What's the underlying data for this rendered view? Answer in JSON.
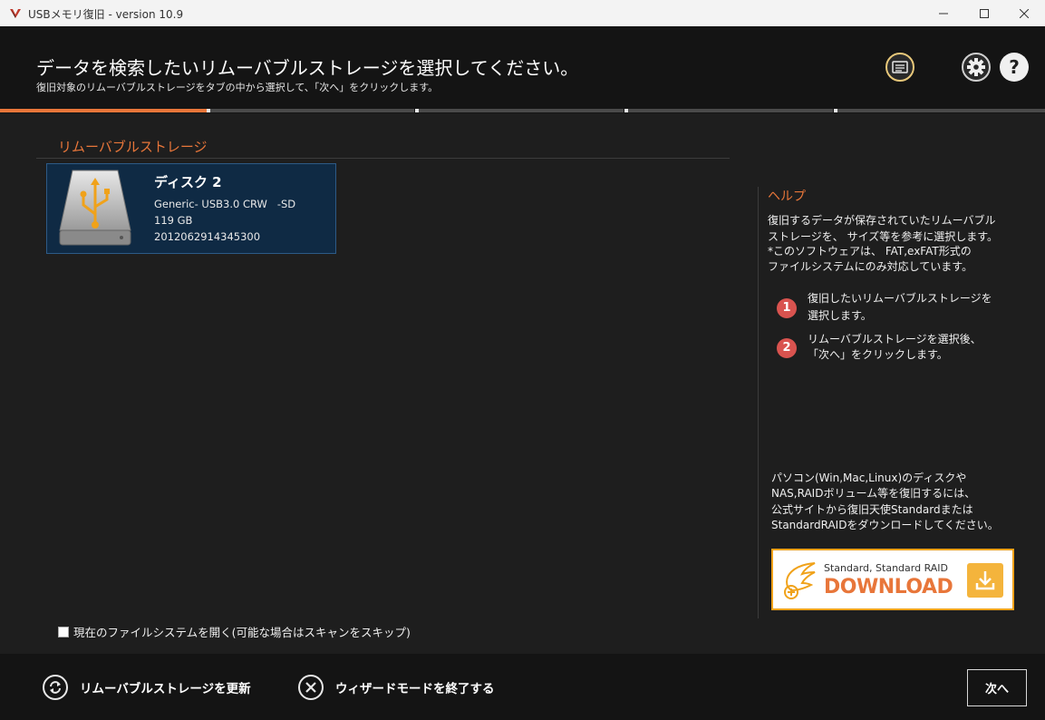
{
  "window": {
    "title": "USBメモリ復旧 - version 10.9",
    "min_icon": "minimize-icon",
    "max_icon": "maximize-icon",
    "close_icon": "close-icon"
  },
  "header": {
    "title": "データを検索したいリムーバブルストレージを選択してください。",
    "subtitle": "復旧対象のリムーバブルストレージをタブの中から選択して、「次へ」をクリックします。",
    "buttons": [
      "log-icon",
      "gear-icon",
      "help-icon"
    ]
  },
  "progress": {
    "current_step": 1,
    "total_steps": 5
  },
  "storage_section": {
    "title": "リムーバブルストレージ",
    "disks": [
      {
        "name": "ディスク 2",
        "model": "Generic- USB3.0 CRW   -SD",
        "size": "119 GB",
        "serial": "2012062914345300",
        "icon": "usb-drive-icon"
      }
    ]
  },
  "help": {
    "title": "ヘルプ",
    "intro_lines": [
      "復旧するデータが保存されていたリムーバブル",
      "ストレージを、 サイズ等を参考に選択します。",
      "*このソフトウェアは、 FAT,exFAT形式の",
      "ファイルシステムにのみ対応しています。"
    ],
    "steps": [
      {
        "num": "1",
        "lines": [
          "復旧したいリムーバブルストレージを",
          "選択します。"
        ]
      },
      {
        "num": "2",
        "lines": [
          "リムーバブルストレージを選択後、",
          "「次へ」をクリックします。"
        ]
      }
    ],
    "promo_lines": [
      "パソコン(Win,Mac,Linux)のディスクや",
      "NAS,RAIDボリューム等を復旧するには、",
      "公式サイトから復旧天使Standardまたは",
      "StandardRAIDをダウンロードしてください。"
    ],
    "banner": {
      "small_text": "Standard, Standard RAID",
      "big_text": "DOWNLOAD",
      "accent": "#f0a21a"
    }
  },
  "options": {
    "open_fs_label": "現在のファイルシステムを開く(可能な場合はスキャンをスキップ)",
    "open_fs_checked": false
  },
  "footer": {
    "refresh_label": "リムーバブルストレージを更新",
    "exit_wizard_label": "ウィザードモードを終了する",
    "next_label": "次へ"
  },
  "colors": {
    "accent": "#e8763a",
    "background": "#1e1e1e",
    "selected_card": "#0f2a44",
    "step_badge": "#d9534f"
  }
}
